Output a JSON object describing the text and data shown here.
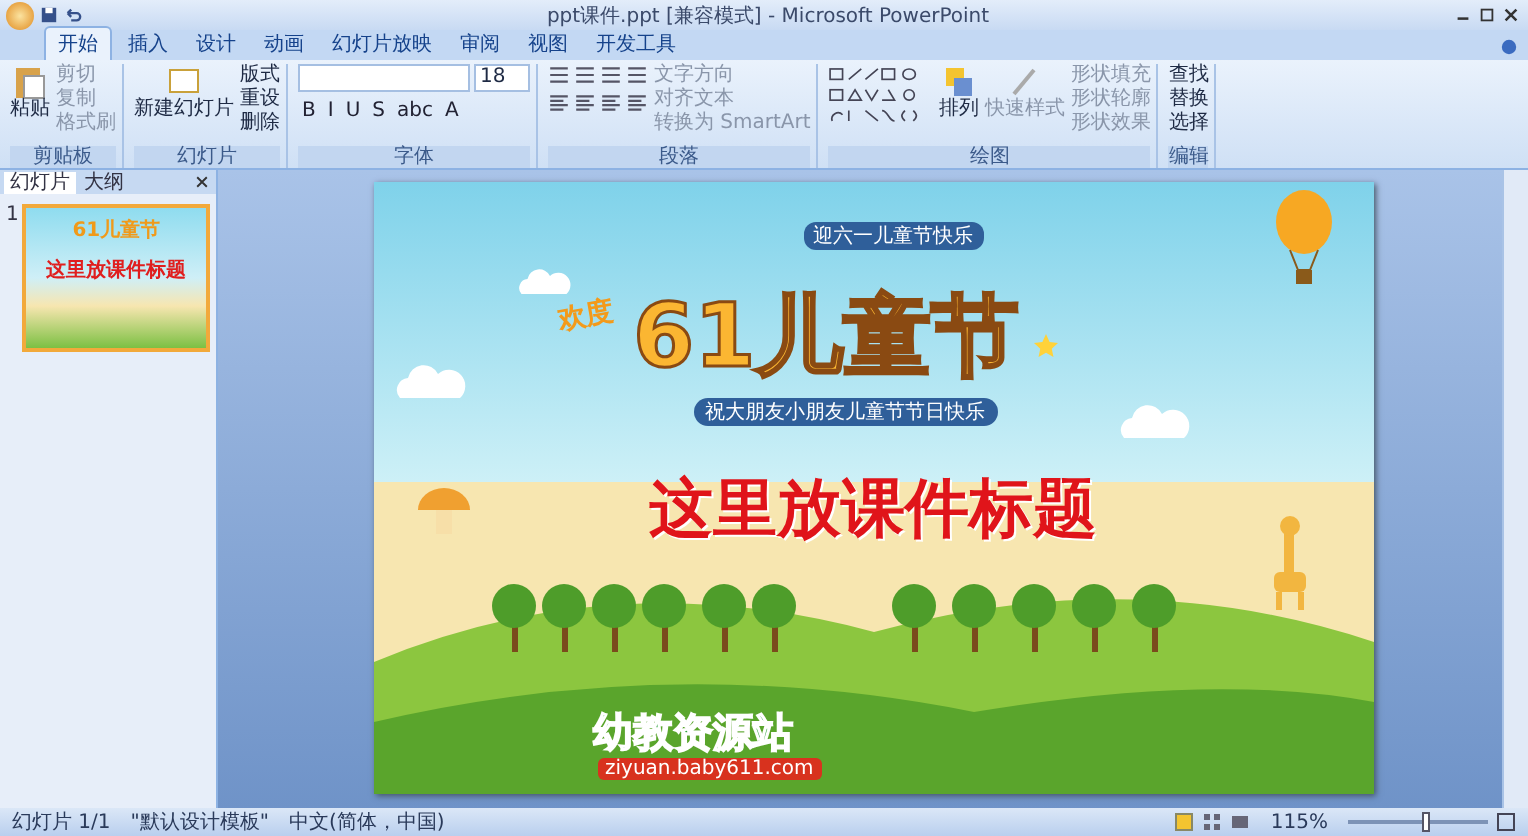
{
  "window": {
    "title": "ppt课件.ppt [兼容模式] - Microsoft PowerPoint"
  },
  "tabs": [
    {
      "label": "开始",
      "selected": true
    },
    {
      "label": "插入",
      "selected": false
    },
    {
      "label": "设计",
      "selected": false
    },
    {
      "label": "动画",
      "selected": false
    },
    {
      "label": "幻灯片放映",
      "selected": false
    },
    {
      "label": "审阅",
      "selected": false
    },
    {
      "label": "视图",
      "selected": false
    },
    {
      "label": "开发工具",
      "selected": false
    }
  ],
  "clipboard": {
    "label": "剪贴板",
    "paste": "粘贴",
    "items": [
      {
        "label": "剪切",
        "disabled": true
      },
      {
        "label": "复制",
        "disabled": true
      },
      {
        "label": "格式刷",
        "disabled": true
      }
    ]
  },
  "slides_group": {
    "label": "幻灯片",
    "new_slide": "新建幻灯片",
    "items": [
      {
        "label": "版式"
      },
      {
        "label": "重设"
      },
      {
        "label": "删除"
      }
    ]
  },
  "font": {
    "label": "字体",
    "size": "18",
    "buttons": [
      "B",
      "I",
      "U",
      "S",
      "abc",
      "A"
    ]
  },
  "paragraph": {
    "label": "段落",
    "items": [
      {
        "label": "文字方向",
        "disabled": true
      },
      {
        "label": "对齐文本",
        "disabled": true
      },
      {
        "label": "转换为 SmartArt",
        "disabled": true
      }
    ]
  },
  "drawing": {
    "label": "绘图",
    "arrange": "排列",
    "quick_styles": "快速样式",
    "items": [
      {
        "label": "形状填充",
        "disabled": true
      },
      {
        "label": "形状轮廓",
        "disabled": true
      },
      {
        "label": "形状效果",
        "disabled": true
      }
    ]
  },
  "editing": {
    "label": "编辑",
    "items": [
      {
        "label": "查找"
      },
      {
        "label": "替换"
      },
      {
        "label": "选择"
      }
    ]
  },
  "panel": {
    "tabs": [
      {
        "label": "幻灯片",
        "selected": true
      },
      {
        "label": "大纲",
        "selected": false
      }
    ],
    "slides": [
      {
        "number": "1",
        "selected": true,
        "logo": "61儿童节",
        "title": "这里放课件标题"
      }
    ]
  },
  "slide": {
    "badge": "迎六一儿童节快乐",
    "greeting": "欢度",
    "logo": "61儿童节",
    "subtitle": "祝大朋友小朋友儿童节节日快乐",
    "title": "这里放课件标题",
    "brand": "幼教资源站",
    "url": "ziyuan.baby611.com"
  },
  "status_bar": {
    "slide": "幻灯片 1/1",
    "theme": "\"默认设计模板\"",
    "language": "中文(简体，中国)",
    "zoom": "115%",
    "zoom_level": {
      "level": 0.55
    }
  }
}
